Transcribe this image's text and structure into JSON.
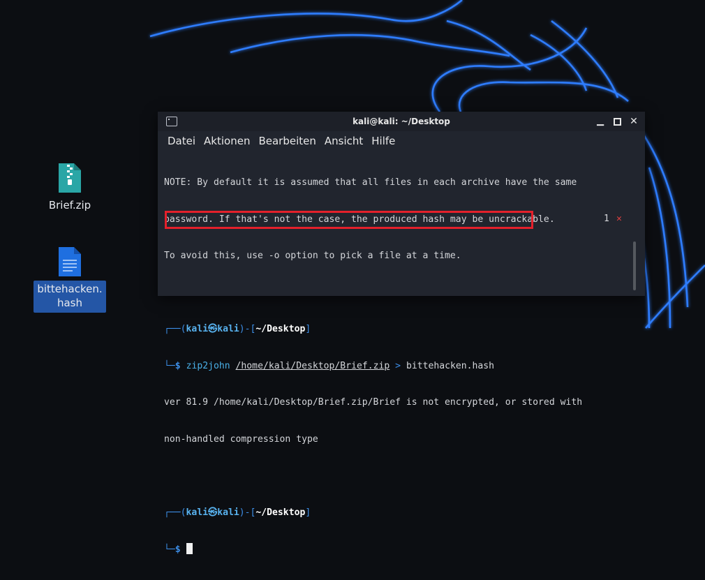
{
  "desktop": {
    "icons": [
      {
        "label": "Brief.zip",
        "type": "zip-file-icon"
      },
      {
        "label": "bittehacken.hash",
        "type": "document-icon"
      }
    ]
  },
  "terminal": {
    "title": "kali@kali: ~/Desktop",
    "menu": [
      "Datei",
      "Aktionen",
      "Bearbeiten",
      "Ansicht",
      "Hilfe"
    ],
    "note_lines": [
      "NOTE: By default it is assumed that all files in each archive have the same",
      "password. If that's not the case, the produced hash may be uncrackable.",
      "To avoid this, use -o option to pick a file at a time."
    ],
    "prompt": {
      "user": "kali",
      "host": "kali",
      "dir": "~/Desktop",
      "symbol": "$"
    },
    "command": {
      "program": "zip2john",
      "arg": "/home/kali/Desktop/Brief.zip",
      "redirect": ">",
      "output_file": "bittehacken.hash"
    },
    "exit_code": "1",
    "output_lines": [
      "ver 81.9 /home/kali/Desktop/Brief.zip/Brief is not encrypted, or stored with",
      "non-handled compression type"
    ]
  },
  "colors": {
    "highlight_border": "#e3202b",
    "prompt_blue": "#3d8fe9",
    "wallpaper_glow": "#1e6cff"
  }
}
